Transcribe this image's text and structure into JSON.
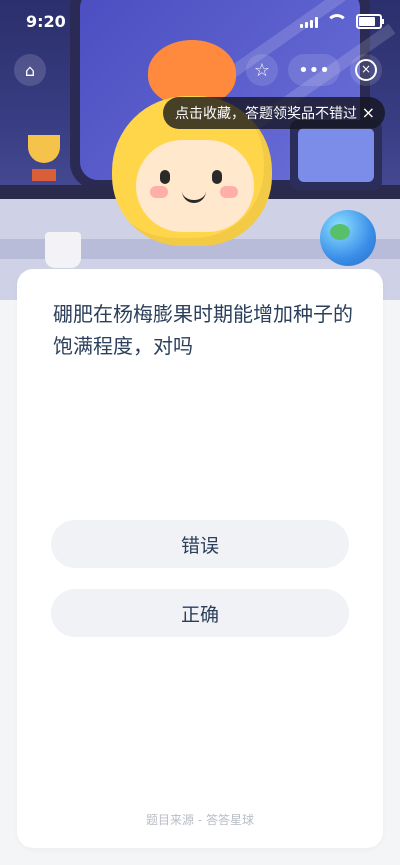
{
  "status_bar": {
    "time": "9:20"
  },
  "top_nav": {
    "home_icon": "home-icon",
    "favorite_icon": "star-icon",
    "more_label": "•••",
    "close_icon": "close-circle-icon"
  },
  "tooltip": {
    "text": "点击收藏，答题领奖品不错过",
    "close_glyph": "×"
  },
  "question": {
    "text": "硼肥在杨梅膨果时期能增加种子的饱满程度，对吗"
  },
  "answers": [
    {
      "label": "错误"
    },
    {
      "label": "正确"
    }
  ],
  "footer": {
    "source": "题目来源 - 答答星球"
  },
  "colors": {
    "card_bg": "#ffffff",
    "button_bg": "#f0f2f5",
    "text": "#2b3f5a",
    "page_bg": "#f4f5f7"
  }
}
